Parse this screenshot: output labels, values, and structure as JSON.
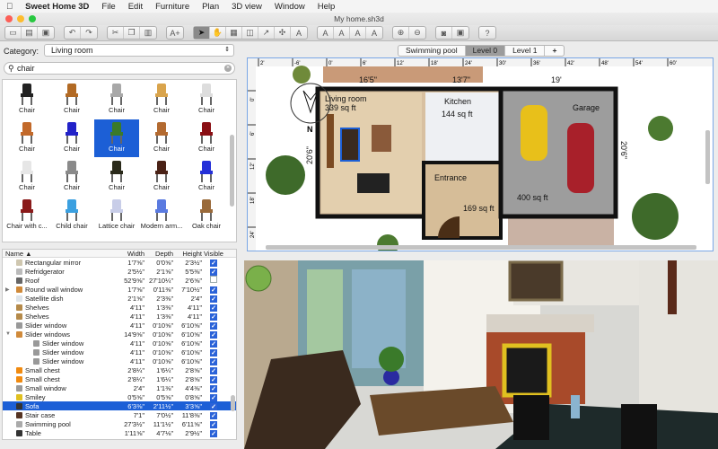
{
  "menubar": {
    "app": "Sweet Home 3D",
    "items": [
      "File",
      "Edit",
      "Furniture",
      "Plan",
      "3D view",
      "Window",
      "Help"
    ]
  },
  "window": {
    "title": "My home.sh3d"
  },
  "toolbar": {
    "groups": [
      [
        "new-file",
        "open",
        "save"
      ],
      [
        "undo",
        "redo"
      ],
      [
        "cut",
        "copy",
        "paste"
      ],
      [
        "add-furniture"
      ],
      [
        "select",
        "pan",
        "create-walls",
        "create-rooms",
        "create-polylines",
        "create-dimensions",
        "add-text"
      ],
      [
        "modify-text-style",
        "bold",
        "italic",
        "text-size"
      ],
      [
        "zoom-in",
        "zoom-out"
      ],
      [
        "create-photo",
        "create-video"
      ],
      [
        "help"
      ]
    ]
  },
  "catalog": {
    "category_label": "Category:",
    "category_value": "Living room",
    "search_value": "chair",
    "items": [
      {
        "name": "Chair",
        "color": "#222222"
      },
      {
        "name": "Chair",
        "color": "#b26a24"
      },
      {
        "name": "Chair",
        "color": "#a8a8a8"
      },
      {
        "name": "Chair",
        "color": "#d9a44c"
      },
      {
        "name": "Chair",
        "color": "#dddddd"
      },
      {
        "name": "Chair",
        "color": "#c2692a"
      },
      {
        "name": "Chair",
        "color": "#2222c8"
      },
      {
        "name": "Chair",
        "color": "#3a7a2a",
        "selected": true
      },
      {
        "name": "Chair",
        "color": "#b36a30"
      },
      {
        "name": "Chair",
        "color": "#8a0f14"
      },
      {
        "name": "Chair",
        "color": "#e6e6e6"
      },
      {
        "name": "Chair",
        "color": "#8a8a8a"
      },
      {
        "name": "Chair",
        "color": "#2a2a1a"
      },
      {
        "name": "Chair",
        "color": "#4a2216"
      },
      {
        "name": "Chair",
        "color": "#2430d8"
      },
      {
        "name": "Chair with c...",
        "color": "#8a1a1a"
      },
      {
        "name": "Child chair",
        "color": "#3ba0e0"
      },
      {
        "name": "Lattice chair",
        "color": "#c8cde8"
      },
      {
        "name": "Modern arm...",
        "color": "#5a7ae0"
      },
      {
        "name": "Oak chair",
        "color": "#9a6a3a"
      }
    ]
  },
  "furniture_table": {
    "columns": [
      "Name ▲",
      "Width",
      "Depth",
      "Height",
      "Visible"
    ],
    "rows": [
      {
        "name": "Rectangular mirror",
        "w": "1'7⅝\"",
        "d": "0'0⅝\"",
        "h": "2'3½\"",
        "visible": true,
        "color": "#cfc7b0"
      },
      {
        "name": "Refridgerator",
        "w": "2'5½\"",
        "d": "2'1⅝\"",
        "h": "5'5⅜\"",
        "visible": true,
        "color": "#bbbbbb"
      },
      {
        "name": "Roof",
        "w": "52'9⅝\"",
        "d": "27'10¼\"",
        "h": "2'6⅝\"",
        "visible": false,
        "color": "#666666"
      },
      {
        "name": "Round wall window",
        "w": "1'7⅝\"",
        "d": "0'11⅜\"",
        "h": "7'10½\"",
        "visible": true,
        "color": "#d08a3a",
        "expander": "▶"
      },
      {
        "name": "Satellite dish",
        "w": "2'1⅝\"",
        "d": "2'3⅜\"",
        "h": "2'4\"",
        "visible": true,
        "color": "#dde4ea"
      },
      {
        "name": "Shelves",
        "w": "4'11\"",
        "d": "1'3⅜\"",
        "h": "4'11\"",
        "visible": true,
        "color": "#b58a4a"
      },
      {
        "name": "Shelves",
        "w": "4'11\"",
        "d": "1'3⅜\"",
        "h": "4'11\"",
        "visible": true,
        "color": "#b58a4a"
      },
      {
        "name": "Slider window",
        "w": "4'11\"",
        "d": "0'10⅝\"",
        "h": "6'10⅝\"",
        "visible": true,
        "color": "#999999"
      },
      {
        "name": "Slider windows",
        "w": "14'9⅝\"",
        "d": "0'10⅝\"",
        "h": "6'10⅝\"",
        "visible": true,
        "color": "#d08a3a",
        "expander": "▼"
      },
      {
        "name": "Slider window",
        "w": "4'11\"",
        "d": "0'10⅝\"",
        "h": "6'10⅝\"",
        "visible": true,
        "color": "#999999",
        "indent": true
      },
      {
        "name": "Slider window",
        "w": "4'11\"",
        "d": "0'10⅝\"",
        "h": "6'10⅝\"",
        "visible": true,
        "color": "#999999",
        "indent": true
      },
      {
        "name": "Slider window",
        "w": "4'11\"",
        "d": "0'10⅝\"",
        "h": "6'10⅝\"",
        "visible": true,
        "color": "#999999",
        "indent": true
      },
      {
        "name": "Small chest",
        "w": "2'8¼\"",
        "d": "1'6¼\"",
        "h": "2'8⅝\"",
        "visible": true,
        "color": "#f08a10"
      },
      {
        "name": "Small chest",
        "w": "2'8¼\"",
        "d": "1'6¼\"",
        "h": "2'8⅝\"",
        "visible": true,
        "color": "#f08a10"
      },
      {
        "name": "Small window",
        "w": "2'4\"",
        "d": "1'1⅜\"",
        "h": "4'4⅜\"",
        "visible": true,
        "color": "#999999"
      },
      {
        "name": "Smiley",
        "w": "0'5⅝\"",
        "d": "0'5⅝\"",
        "h": "0'8⅝\"",
        "visible": true,
        "color": "#e0c020"
      },
      {
        "name": "Sofa",
        "w": "6'3⅜\"",
        "d": "2'11½\"",
        "h": "3'3⅝\"",
        "visible": true,
        "color": "#333333",
        "selected": true
      },
      {
        "name": "Stair case",
        "w": "7'1\"",
        "d": "7'0½\"",
        "h": "11'8⅜\"",
        "visible": true,
        "color": "#553322"
      },
      {
        "name": "Swimming pool",
        "w": "27'3½\"",
        "d": "11'1½\"",
        "h": "6'11⅝\"",
        "visible": true,
        "color": "#aaaaaa"
      },
      {
        "name": "Table",
        "w": "1'11⅝\"",
        "d": "4'7⅛\"",
        "h": "2'9½\"",
        "visible": true,
        "color": "#333333"
      }
    ]
  },
  "plan": {
    "levels": [
      "Swimming pool",
      "Level 0",
      "Level 1",
      "+"
    ],
    "active_level": "Level 0",
    "ruler_x": [
      "2'",
      "-6'",
      "0'",
      "6'",
      "12'",
      "18'",
      "24'",
      "30'",
      "36'",
      "42'",
      "48'",
      "54'",
      "60'"
    ],
    "ruler_y": [
      "0'",
      "6'",
      "12'",
      "18'",
      "24'"
    ],
    "dimensions": [
      "16'5\"",
      "13'7\"",
      "19'",
      "20'6\"",
      "20'6\""
    ],
    "rooms": [
      {
        "name": "Living room",
        "area": "339 sq ft"
      },
      {
        "name": "Kitchen",
        "area": "144 sq ft"
      },
      {
        "name": "Garage",
        "area": "400 sq ft"
      },
      {
        "name": "Entrance",
        "area": "169 sq ft"
      }
    ],
    "compass_label": "N"
  },
  "colors": {
    "selection": "#1c5fd6",
    "accent": "#7aa7e6",
    "garage": "#9a9a9a",
    "floor": "#d9c3a2"
  }
}
